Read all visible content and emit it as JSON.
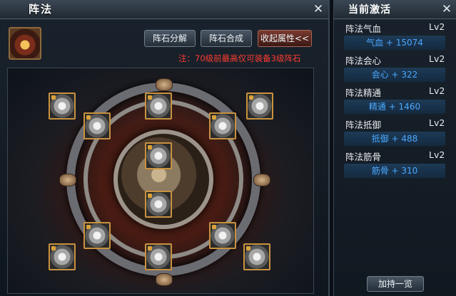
{
  "main": {
    "title": "阵法",
    "buttons": {
      "decompose": "阵石分解",
      "compose": "阵石合成",
      "collapse": "收起属性<<"
    },
    "note": "注：70级前最高仅可装备3级阵石",
    "close": "✕"
  },
  "side": {
    "title": "当前激活",
    "close": "✕",
    "stats": [
      {
        "name": "阵法气血",
        "level": "Lv2",
        "bonus": "气血 + 15074"
      },
      {
        "name": "阵法会心",
        "level": "Lv2",
        "bonus": "会心 + 322"
      },
      {
        "name": "阵法精通",
        "level": "Lv2",
        "bonus": "精通 + 1460"
      },
      {
        "name": "阵法抵御",
        "level": "Lv2",
        "bonus": "抵御 + 488"
      },
      {
        "name": "阵法筋骨",
        "level": "Lv2",
        "bonus": "筋骨 + 310"
      }
    ],
    "footer_button": "加持一览"
  },
  "colors": {
    "note_red": "#ff3b2f",
    "bonus_blue": "#4aa8ff",
    "slot_border": "#c9923f"
  }
}
